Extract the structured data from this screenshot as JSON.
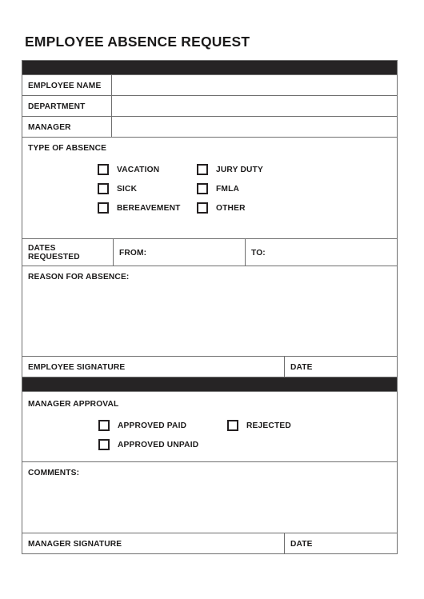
{
  "document": {
    "title": "EMPLOYEE ABSENCE REQUEST"
  },
  "colors": {
    "bar": "#262425",
    "border": "#6f6f6f",
    "text": "#1b1a1a"
  },
  "employee_section": {
    "fields": [
      {
        "label": "EMPLOYEE NAME",
        "value": ""
      },
      {
        "label": "DEPARTMENT",
        "value": ""
      },
      {
        "label": "MANAGER",
        "value": ""
      }
    ]
  },
  "absence_type": {
    "label": "TYPE OF ABSENCE",
    "options_left": [
      {
        "label": "VACATION",
        "checked": false
      },
      {
        "label": "SICK",
        "checked": false
      },
      {
        "label": "BEREAVEMENT",
        "checked": false
      }
    ],
    "options_right": [
      {
        "label": "JURY DUTY",
        "checked": false
      },
      {
        "label": "FMLA",
        "checked": false
      },
      {
        "label": "OTHER",
        "checked": false
      }
    ]
  },
  "dates": {
    "label": "DATES REQUESTED",
    "from_label": "FROM:",
    "from_value": "",
    "to_label": "TO:",
    "to_value": ""
  },
  "reason": {
    "label": "REASON FOR ABSENCE:",
    "value": ""
  },
  "employee_signature": {
    "label": "EMPLOYEE SIGNATURE",
    "value": "",
    "date_label": "DATE",
    "date_value": ""
  },
  "manager_approval": {
    "label": "MANAGER APPROVAL",
    "options_left": [
      {
        "label": "APPROVED PAID",
        "checked": false
      },
      {
        "label": "APPROVED UNPAID",
        "checked": false
      }
    ],
    "options_right": [
      {
        "label": "REJECTED",
        "checked": false
      }
    ]
  },
  "comments": {
    "label": "COMMENTS:",
    "value": ""
  },
  "manager_signature": {
    "label": "MANAGER SIGNATURE",
    "value": "",
    "date_label": "DATE",
    "date_value": ""
  }
}
